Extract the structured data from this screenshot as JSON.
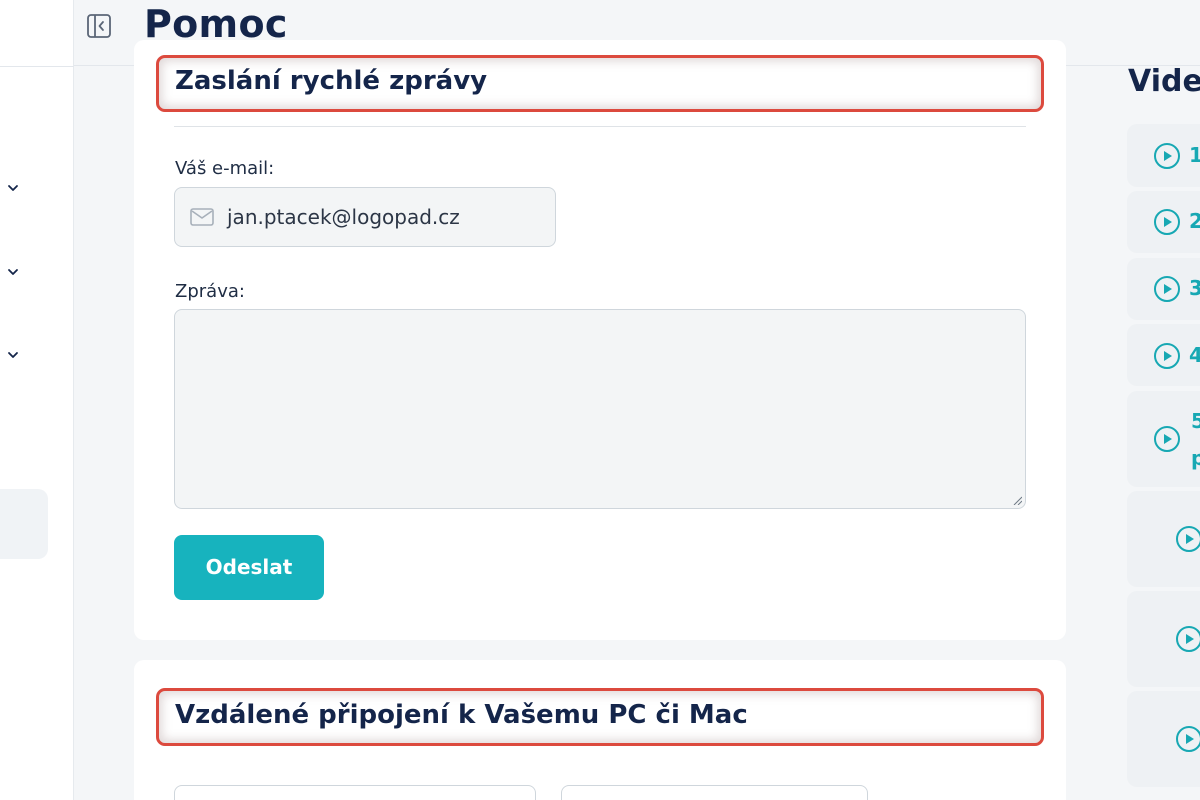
{
  "header": {
    "title": "Pomoc"
  },
  "quick_message": {
    "title": "Zaslání rychlé zprávy",
    "email_label": "Váš e-mail:",
    "email_value": "jan.ptacek@logopad.cz",
    "message_label": "Zpráva:",
    "message_value": "",
    "send_label": "Odeslat"
  },
  "remote": {
    "title": "Vzdálené připojení k Vašemu PC či Mac"
  },
  "videos": {
    "title": "Videa",
    "items": [
      {
        "num": "1"
      },
      {
        "num": "2"
      },
      {
        "num": "3"
      },
      {
        "num": "4"
      },
      {
        "num": "5",
        "extra": "p"
      },
      {
        "num": ""
      },
      {
        "num": ""
      },
      {
        "num": ""
      }
    ]
  },
  "colors": {
    "accent": "#17b3be",
    "title": "#14254a",
    "highlight": "#dc4a3e"
  }
}
